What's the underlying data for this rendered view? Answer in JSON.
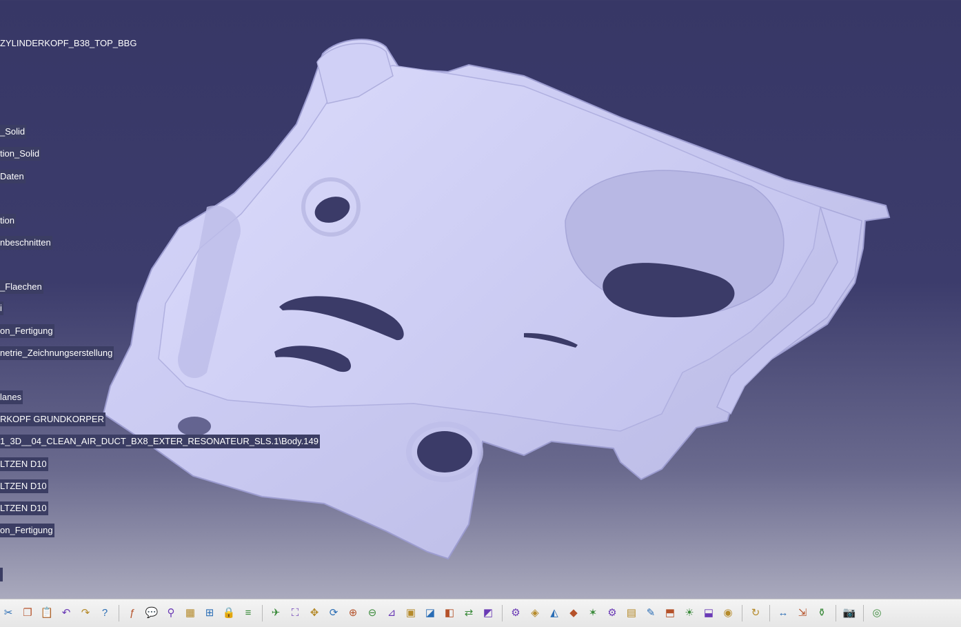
{
  "spec_tree": {
    "root": "ZYLINDERKOPF_B38_TOP_BBG",
    "nodes": [
      "_Solid",
      "tion_Solid",
      "Daten",
      "tion",
      "nbeschnitten",
      "_Flaechen",
      "i",
      "on_Fertigung",
      "netrie_Zeichnungserstellung",
      "lanes",
      "RKOPF GRUNDKORPER",
      "1_3D__04_CLEAN_AIR_DUCT_BX8_EXTER_RESONATEUR_SLS.1\\Body.149",
      "LTZEN D10",
      "LTZEN D10",
      "LTZEN D10",
      "on_Fertigung"
    ]
  },
  "toolbar": {
    "groups": [
      [
        "cut-icon",
        "copy-icon",
        "paste-icon",
        "undo-icon",
        "redo-icon",
        "whats-this-icon"
      ],
      [
        "formula-icon",
        "comment-icon",
        "knowledge-icon",
        "table-icon",
        "hierarchy-icon",
        "lock-icon",
        "parameters-icon"
      ],
      [
        "fly-mode-icon",
        "fit-all-icon",
        "pan-icon",
        "rotate-icon",
        "zoom-in-icon",
        "zoom-out-icon",
        "normal-view-icon",
        "multi-view-icon",
        "iso-view-icon",
        "hide-show-icon",
        "swap-space-icon",
        "shading-icon"
      ],
      [
        "measure-icon",
        "analysis-icon",
        "draft-analysis-icon",
        "surface-analysis-icon",
        "mapping-icon",
        "settings-icon",
        "catalog-icon",
        "sketch-icon",
        "surface-icon",
        "light-icon",
        "environment-icon",
        "render-icon"
      ],
      [
        "update-icon"
      ],
      [
        "measure-between-icon",
        "measure-item-icon",
        "inertia-icon"
      ],
      [
        "capture-icon"
      ],
      [
        "cycle-icon"
      ]
    ]
  },
  "colors": {
    "background_top": "#373766",
    "background_bottom": "#b8b8c6",
    "part_shade": "#c9c9f2",
    "tree_label_bg": "#3b3d63"
  }
}
